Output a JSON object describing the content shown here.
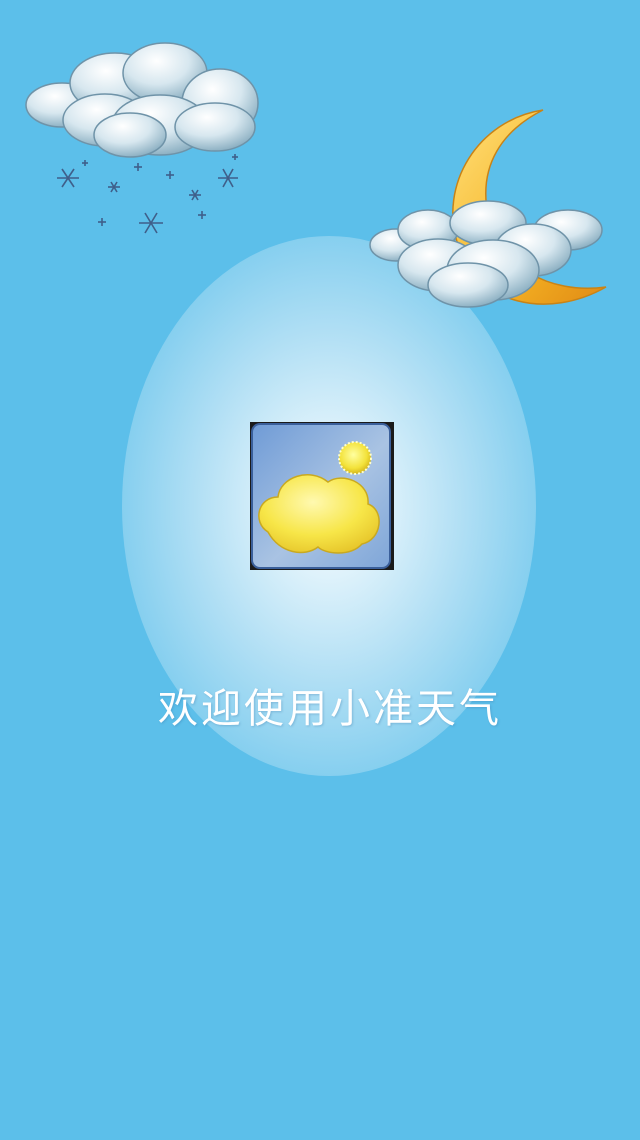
{
  "splash": {
    "welcome_text": "欢迎使用小准天气"
  },
  "icons": {
    "top_left": "snow-cloud-icon",
    "top_right": "moon-cloud-icon",
    "center": "app-logo-sun-cloud-icon"
  },
  "colors": {
    "background": "#5cbfea",
    "welcome_text": "#ffffff",
    "moon": "#f5b324",
    "logo_cloud": "#f7e648"
  }
}
